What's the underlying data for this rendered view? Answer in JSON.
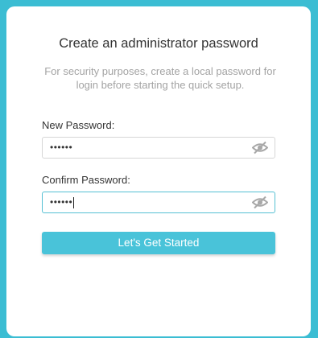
{
  "dialog": {
    "title": "Create an administrator password",
    "subtitle": "For security purposes, create a local password for login before starting the quick setup."
  },
  "new_password": {
    "label": "New Password:",
    "value_masked": "••••••",
    "toggle_icon": "eye-off-icon"
  },
  "confirm_password": {
    "label": "Confirm Password:",
    "value_masked": "••••••",
    "toggle_icon": "eye-off-icon"
  },
  "actions": {
    "start_label": "Let's Get Started"
  },
  "colors": {
    "background": "#3bbdd3",
    "accent": "#49c3d9",
    "focus_border": "#55c0d3"
  }
}
